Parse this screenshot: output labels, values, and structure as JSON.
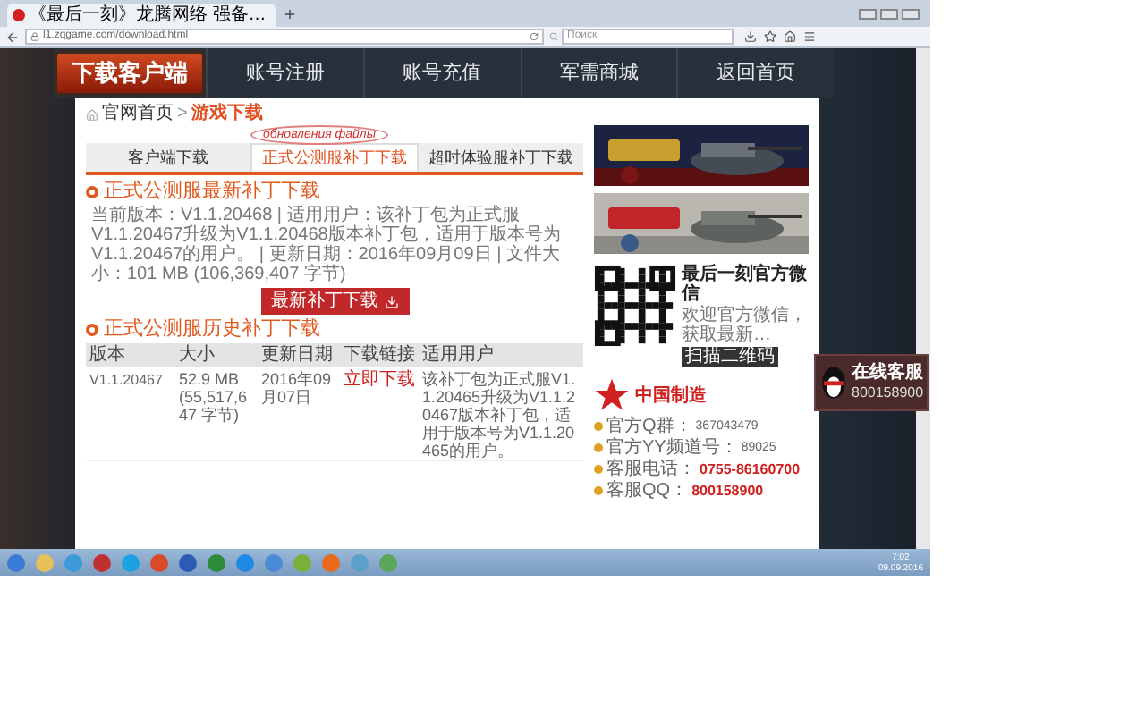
{
  "browser": {
    "tab_title": "《最后一刻》龙腾网络 强备…",
    "url": "l1.zqgame.com/download.html",
    "search_placeholder": "Поиск"
  },
  "header": {
    "download_button": "下载客户端",
    "nav": [
      "账号注册",
      "账号充值",
      "军需商城",
      "返回首页"
    ]
  },
  "breadcrumb": {
    "home": "官网首页",
    "separator": ">",
    "current": "游戏下载"
  },
  "annotation": "обновления файлы",
  "tabs": [
    {
      "label": "客户端下载",
      "selected": false
    },
    {
      "label": "正式公测服补丁下载",
      "selected": true
    },
    {
      "label": "超时体验服补丁下载",
      "selected": false
    }
  ],
  "latest": {
    "title": "正式公测服最新补丁下载",
    "details": "当前版本：V1.1.20468 | 适用用户：该补丁包为正式服V1.1.20467升级为V1.1.20468版本补丁包，适用于版本号为V1.1.20467的用户。 | 更新日期：2016年09月09日 | 文件大小：101 MB (106,369,407 字节)",
    "button": "最新补丁下载"
  },
  "history": {
    "title": "正式公测服历史补丁下载",
    "columns": [
      "版本",
      "大小",
      "更新日期",
      "下载链接",
      "适用用户"
    ],
    "rows": [
      {
        "version": "V1.1.20467",
        "size": "52.9 MB (55,517,647 字节)",
        "date": "2016年09月07日",
        "link": "立即下载",
        "users": "该补丁包为正式服V1.1.20465升级为V1.1.20467版本补丁包，适用于版本号为V1.1.20465的用户。"
      }
    ]
  },
  "sidebar": {
    "wechat": {
      "title": "最后一刻官方微信",
      "subtitle": "欢迎官方微信，获取最新…",
      "button": "扫描二维码"
    },
    "logo_text": "中国制造",
    "contacts": [
      {
        "label": "官方Q群：",
        "value": "367043479",
        "kind": "plain"
      },
      {
        "label": "官方YY频道号：",
        "value": "89025",
        "kind": "plain"
      },
      {
        "label": "客服电话：",
        "value": "0755-86160700",
        "kind": "highlight"
      },
      {
        "label": "客服QQ：",
        "value": "800158900",
        "kind": "highlight"
      }
    ]
  },
  "chat_widget": {
    "title": "在线客服",
    "number": "800158900"
  },
  "taskbar": {
    "time": "7:02",
    "date": "09.09.2016"
  }
}
